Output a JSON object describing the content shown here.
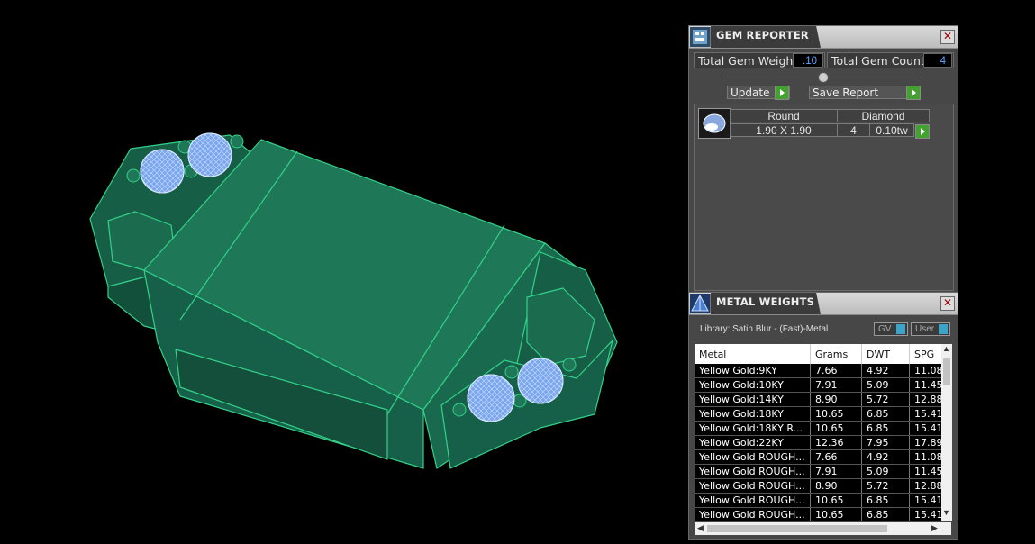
{
  "gem_reporter": {
    "title": "GEM REPORTER",
    "total_weight_label": "Total Gem Weight",
    "total_weight_value": ".10",
    "total_count_label": "Total Gem Count",
    "total_count_value": "4",
    "update_label": "Update",
    "save_label": "Save Report",
    "gem": {
      "shape": "Round",
      "type": "Diamond",
      "size": "1.90 X 1.90",
      "count": "4",
      "weight": "0.10tw"
    }
  },
  "metal_weights": {
    "title": "METAL WEIGHTS",
    "library": "Library: Satin Blur - (Fast)-Metal",
    "gv_label": "GV",
    "user_label": "User",
    "columns": [
      "Metal",
      "Grams",
      "DWT",
      "SPG"
    ],
    "rows": [
      [
        "Yellow Gold:9KY",
        "7.66",
        "4.92",
        "11.08"
      ],
      [
        "Yellow Gold:10KY",
        "7.91",
        "5.09",
        "11.45"
      ],
      [
        "Yellow Gold:14KY",
        "8.90",
        "5.72",
        "12.88"
      ],
      [
        "Yellow Gold:18KY",
        "10.65",
        "6.85",
        "15.41"
      ],
      [
        "Yellow Gold:18KY R...",
        "10.65",
        "6.85",
        "15.41"
      ],
      [
        "Yellow Gold:22KY",
        "12.36",
        "7.95",
        "17.89"
      ],
      [
        "Yellow Gold ROUGH...",
        "7.66",
        "4.92",
        "11.08"
      ],
      [
        "Yellow Gold ROUGH...",
        "7.91",
        "5.09",
        "11.45"
      ],
      [
        "Yellow Gold ROUGH...",
        "8.90",
        "5.72",
        "12.88"
      ],
      [
        "Yellow Gold ROUGH...",
        "10.65",
        "6.85",
        "15.41"
      ],
      [
        "Yellow Gold ROUGH...",
        "10.65",
        "6.85",
        "15.41"
      ]
    ]
  },
  "colors": {
    "model_green": "#1f7a5a",
    "gem_blue": "#8fb8f0",
    "accent_green": "#43a12f"
  }
}
